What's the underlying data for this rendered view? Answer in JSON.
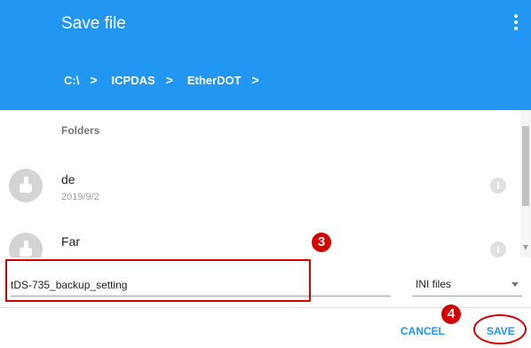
{
  "dialog": {
    "title": "Save file",
    "more_icon": "more-vertical-icon"
  },
  "breadcrumb": [
    {
      "label": "C:\\"
    },
    {
      "label": "ICPDAS"
    },
    {
      "label": "EtherDOT"
    }
  ],
  "breadcrumb_separator": ">",
  "list": {
    "section_label": "Folders",
    "items": [
      {
        "name": "de",
        "date": "2019/9/2",
        "icon": "touch-icon",
        "info_icon": "info-icon"
      },
      {
        "name": "Far",
        "date": "",
        "icon": "touch-icon",
        "info_icon": "info-icon"
      }
    ]
  },
  "filename": {
    "value": "tDS-735_backup_setting"
  },
  "filetype": {
    "selected": "INI files"
  },
  "actions": {
    "cancel_label": "CANCEL",
    "save_label": "SAVE"
  },
  "annotations": {
    "step_3": "3",
    "step_4": "4",
    "color": "#d50000"
  },
  "colors": {
    "accent": "#2196F3"
  }
}
